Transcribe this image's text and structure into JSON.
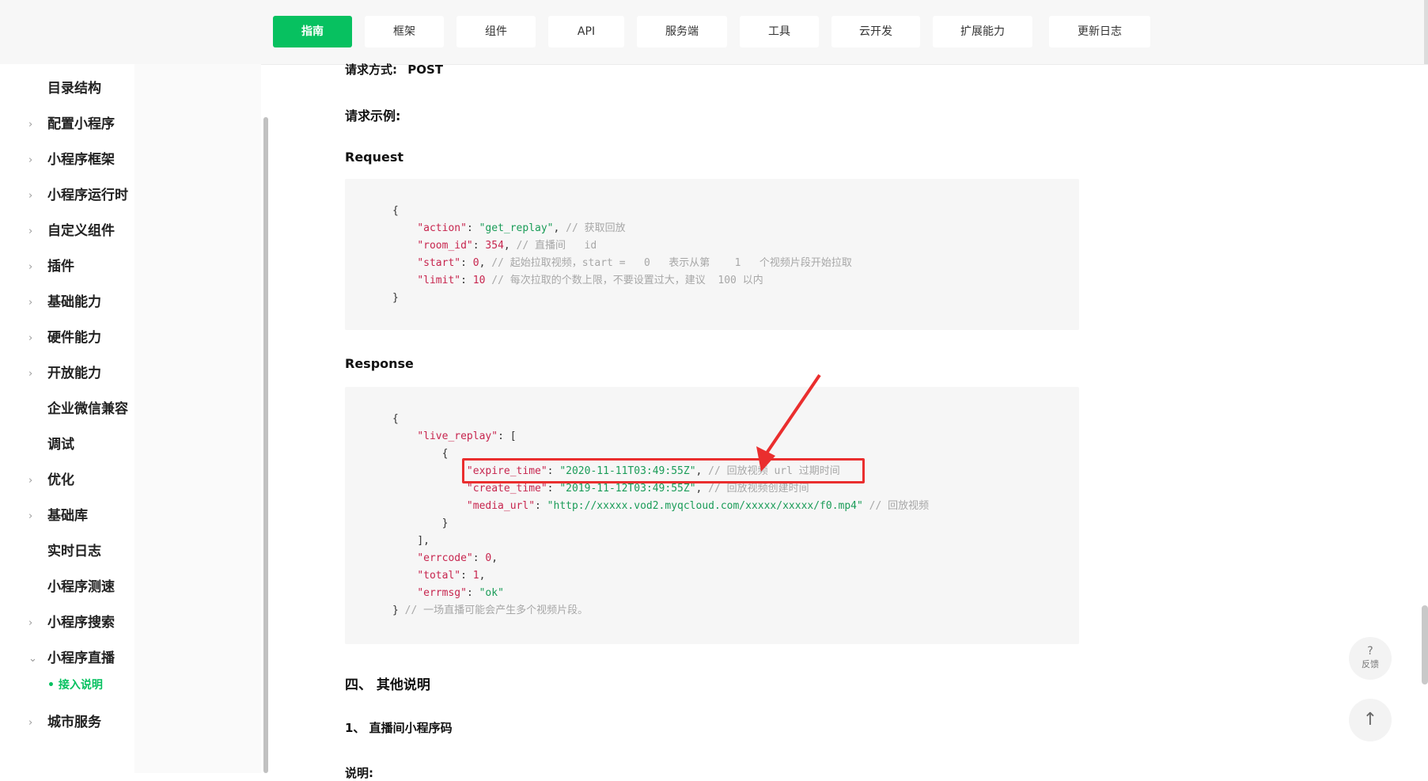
{
  "nav": {
    "tabs": [
      "指南",
      "框架",
      "组件",
      "API",
      "服务端",
      "工具",
      "云开发",
      "扩展能力",
      "更新日志"
    ],
    "active": "指南"
  },
  "sidebar": {
    "items": [
      {
        "label": "目录结构",
        "chevron": ""
      },
      {
        "label": "配置小程序",
        "chevron": "›"
      },
      {
        "label": "小程序框架",
        "chevron": "›"
      },
      {
        "label": "小程序运行时",
        "chevron": "›"
      },
      {
        "label": "自定义组件",
        "chevron": "›"
      },
      {
        "label": "插件",
        "chevron": "›"
      },
      {
        "label": "基础能力",
        "chevron": "›"
      },
      {
        "label": "硬件能力",
        "chevron": "›"
      },
      {
        "label": "开放能力",
        "chevron": "›"
      },
      {
        "label": "企业微信兼容",
        "chevron": ""
      },
      {
        "label": "调试",
        "chevron": ""
      },
      {
        "label": "优化",
        "chevron": "›"
      },
      {
        "label": "基础库",
        "chevron": "›"
      },
      {
        "label": "实时日志",
        "chevron": ""
      },
      {
        "label": "小程序测速",
        "chevron": ""
      },
      {
        "label": "小程序搜索",
        "chevron": "›"
      },
      {
        "label": "小程序直播",
        "chevron": "⌄"
      },
      {
        "label": "城市服务",
        "chevron": "›"
      }
    ],
    "sub_item": "• 接入说明"
  },
  "content": {
    "method_label": "请求方式:",
    "method_value": "POST",
    "request_example": "请求示例:",
    "request_title": "Request",
    "response_title": "Response",
    "section4": "四、 其他说明",
    "section4_1": "1、 直播间小程序码",
    "note": "说明:"
  },
  "request_code": {
    "open": "{",
    "k1": "\"action\"",
    "v1": "\"get_replay\"",
    "c1": "// 获取回放",
    "k2": "\"room_id\"",
    "v2": "354",
    "c2": "// 直播间   id",
    "k3": "\"start\"",
    "v3": "0",
    "c3": "// 起始拉取视频，start =   0   表示从第    1   个视频片段开始拉取",
    "k4": "\"limit\"",
    "v4": "10",
    "c4": "// 每次拉取的个数上限，不要设置过大，建议  100 以内",
    "close": "}"
  },
  "response_code": {
    "open": "{",
    "live_replay_key": "\"live_replay\"",
    "arr_open": "[",
    "obj_open": "{",
    "exp_k": "\"expire_time\"",
    "exp_v": "\"2020-11-11T03:49:55Z\"",
    "exp_c": "// 回放视频 url 过期时间",
    "cre_k": "\"create_time\"",
    "cre_v": "\"2019-11-12T03:49:55Z\"",
    "cre_c": "// 回放视频创建时间",
    "med_k": "\"media_url\"",
    "med_v": "\"http://xxxxx.vod2.myqcloud.com/xxxxx/xxxxx/f0.mp4\"",
    "med_c": "// 回放视频",
    "obj_close": "}",
    "arr_close": "],",
    "err_k": "\"errcode\"",
    "err_v": "0",
    "tot_k": "\"total\"",
    "tot_v": "1",
    "msg_k": "\"errmsg\"",
    "msg_v": "\"ok\"",
    "close": "}",
    "close_c": "// 一场直播可能会产生多个视频片段。"
  },
  "widgets": {
    "feedback_icon": "?",
    "feedback_label": "反馈",
    "top_icon": "↑"
  },
  "colors": {
    "accent": "#07c160",
    "highlight_border": "#ea2e2e"
  }
}
